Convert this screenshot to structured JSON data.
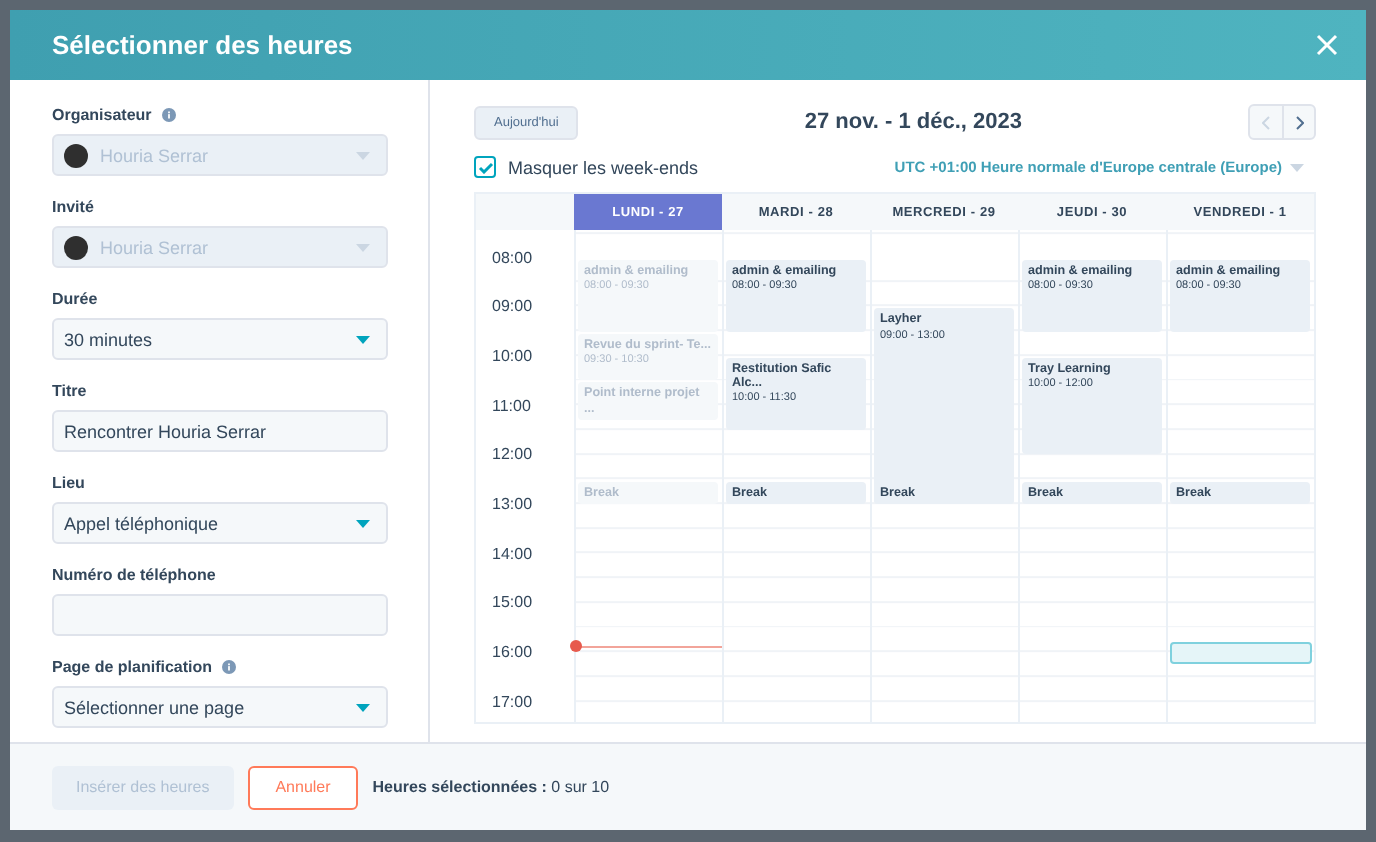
{
  "dialog": {
    "title": "Sélectionner des heures"
  },
  "form": [
    {
      "kind": "person",
      "label": "Organisateur",
      "info": true,
      "value": "Houria Serrar",
      "disabled": true
    },
    {
      "kind": "person",
      "label": "Invité",
      "info": false,
      "value": "Houria Serrar",
      "disabled": true
    },
    {
      "kind": "select",
      "label": "Durée",
      "info": false,
      "value": "30 minutes",
      "disabled": false
    },
    {
      "kind": "input",
      "label": "Titre",
      "info": false,
      "value": "Rencontrer Houria Serrar"
    },
    {
      "kind": "select",
      "label": "Lieu",
      "info": false,
      "value": "Appel téléphonique",
      "disabled": false
    },
    {
      "kind": "input",
      "label": "Numéro de téléphone",
      "info": false
    },
    {
      "kind": "select",
      "label": "Page de planification",
      "info": true,
      "value": "Sélectionner une page",
      "disabled": false
    }
  ],
  "calendar": {
    "today_button": "Aujourd'hui",
    "range": "27 nov. - 1 déc., 2023",
    "hide_weekends": {
      "label": "Masquer les week-ends",
      "checked": true
    },
    "timezone": "UTC +01:00 Heure normale d'Europe centrale (Europe)",
    "hours": [
      "08:00",
      "09:00",
      "10:00",
      "11:00",
      "12:00",
      "13:00",
      "14:00",
      "15:00",
      "16:00",
      "17:00"
    ],
    "days": [
      {
        "label": "LUNDI - 27",
        "selected": true,
        "past": true,
        "slot": false,
        "events": [
          {
            "kind": "event",
            "title": "admin & emailing",
            "time": "08:00 - 09:30"
          },
          {
            "kind": "event",
            "title": "Revue du sprint- Te...",
            "time": "09:30 - 10:30"
          },
          {
            "kind": "event",
            "title": "Point interne projet ..."
          },
          {
            "kind": "break",
            "title": "Break"
          }
        ]
      },
      {
        "label": "MARDI - 28",
        "selected": false,
        "past": false,
        "slot": false,
        "events": [
          {
            "kind": "event",
            "title": "admin & emailing",
            "time": "08:00 - 09:30"
          },
          {
            "kind": "event",
            "title": "Restitution Safic Alc...",
            "time": "10:00 - 11:30"
          },
          {
            "kind": "break",
            "title": "Break"
          }
        ]
      },
      {
        "label": "MERCREDI - 29",
        "selected": false,
        "past": false,
        "slot": false,
        "events": [
          {
            "kind": "event",
            "title": "Layher",
            "time": "09:00 - 13:00"
          },
          {
            "kind": "break",
            "title": "Break"
          }
        ]
      },
      {
        "label": "JEUDI - 30",
        "selected": false,
        "past": false,
        "slot": false,
        "events": [
          {
            "kind": "event",
            "title": "admin & emailing",
            "time": "08:00 - 09:30"
          },
          {
            "kind": "event",
            "title": "Tray Learning",
            "time": "10:00 - 12:00"
          },
          {
            "kind": "break",
            "title": "Break"
          }
        ]
      },
      {
        "label": "VENDREDI - 1",
        "selected": false,
        "past": false,
        "slot": true,
        "events": [
          {
            "kind": "event",
            "title": "admin & emailing",
            "time": "08:00 - 09:30"
          },
          {
            "kind": "break",
            "title": "Break"
          }
        ]
      }
    ]
  },
  "footer": {
    "insert_button": {
      "label": "Insérer des heures",
      "disabled": true
    },
    "cancel_button": "Annuler",
    "summary": "**Heures sélectionnées :** 0 sur 10"
  }
}
